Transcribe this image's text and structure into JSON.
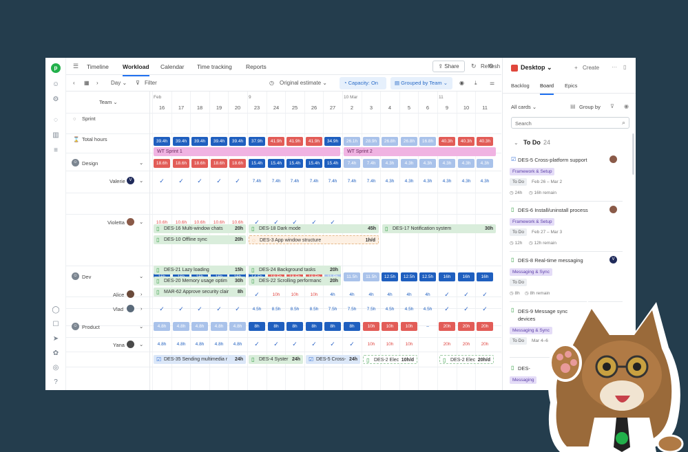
{
  "nav": {
    "tabs": [
      "Timeline",
      "Workload",
      "Calendar",
      "Time tracking",
      "Reports"
    ],
    "share": "Share",
    "refresh": "Refresh"
  },
  "toolbar": {
    "day": "Day",
    "filter": "Filter",
    "estimate": "Original estimate",
    "capacity": "Capacity: On",
    "grouped": "Grouped by Team"
  },
  "grid": {
    "team_label": "Team",
    "months": [
      {
        "label": "Feb",
        "col": 0
      },
      {
        "label": "9",
        "col": 5
      },
      {
        "label": "10 Mar",
        "col": 10
      },
      {
        "label": "11",
        "col": 15
      }
    ],
    "days": [
      "16",
      "17",
      "18",
      "19",
      "20",
      "23",
      "24",
      "25",
      "26",
      "27",
      "2",
      "3",
      "4",
      "5",
      "6",
      "9",
      "10",
      "11"
    ],
    "sprint_label": "Sprint",
    "sprints": [
      "WT Sprint 1",
      "WT Sprint 2"
    ],
    "total_label": "Total hours",
    "total_row": [
      "39.4h",
      "39.4h",
      "39.4h",
      "39.4h",
      "39.4h",
      "37.9h",
      "41.9h",
      "41.9h",
      "41.9h",
      "34.9h",
      "26.1h",
      "28.9h",
      "26.8h",
      "26.8h",
      "16.8h",
      "40.3h",
      "40.3h",
      "40.3h"
    ],
    "teams": {
      "design": "Design",
      "dev": "Dev",
      "product": "Product"
    },
    "design_row": [
      "18.6h",
      "18.6h",
      "18.6h",
      "18.6h",
      "18.6h",
      "15.4h",
      "15.4h",
      "15.4h",
      "15.4h",
      "15.4h",
      "7.4h",
      "7.4h",
      "4.3h",
      "4.3h",
      "4.3h",
      "4.3h",
      "4.3h",
      "4.3h"
    ],
    "valerie": {
      "name": "Valerie",
      "initial": "V",
      "row": [
        "✓",
        "✓",
        "✓",
        "✓",
        "✓",
        "7.4h",
        "7.4h",
        "7.4h",
        "7.4h",
        "7.4h",
        "7.4h",
        "7.4h",
        "4.3h",
        "4.3h",
        "4.3h",
        "4.3h",
        "4.3h",
        "4.3h"
      ]
    },
    "violetta": {
      "name": "Violetta",
      "row": [
        "10.6h",
        "10.6h",
        "10.6h",
        "10.6h",
        "10.6h",
        "✓",
        "✓",
        "✓",
        "✓",
        "✓",
        "",
        "",
        "",
        "",
        "",
        "",
        "",
        ""
      ]
    },
    "dev_row": [
      "16h",
      "16h",
      "16h",
      "16h",
      "16h",
      "14.5h",
      "18.5h",
      "18.5h",
      "18.5h",
      "11.5h",
      "11.5h",
      "11.5h",
      "12.5h",
      "12.5h",
      "12.5h",
      "16h",
      "16h",
      "16h"
    ],
    "alice": {
      "name": "Alice",
      "row": [
        "✓",
        "✓",
        "✓",
        "✓",
        "✓",
        "✓",
        "10h",
        "10h",
        "10h",
        "4h",
        "4h",
        "4h",
        "4h",
        "4h",
        "4h",
        "✓",
        "✓",
        "✓"
      ]
    },
    "vlad": {
      "name": "Vlad",
      "row": [
        "✓",
        "✓",
        "✓",
        "✓",
        "✓",
        "4.5h",
        "8.5h",
        "8.5h",
        "8.5h",
        "7.5h",
        "7.5h",
        "7.5h",
        "4.5h",
        "4.5h",
        "4.5h",
        "✓",
        "✓",
        "✓"
      ]
    },
    "product_row": [
      "4.8h",
      "4.8h",
      "4.8h",
      "4.8h",
      "4.8h",
      "8h",
      "8h",
      "8h",
      "8h",
      "8h",
      "8h",
      "10h",
      "10h",
      "10h",
      "–",
      "20h",
      "20h",
      "20h"
    ],
    "yana": {
      "name": "Yana",
      "row": [
        "4.8h",
        "4.8h",
        "4.8h",
        "4.8h",
        "4.8h",
        "✓",
        "✓",
        "✓",
        "✓",
        "✓",
        "✓",
        "10h",
        "10h",
        "10h",
        "",
        "20h",
        "20h",
        "20h"
      ]
    },
    "bars": [
      {
        "text": "DES-16 Multi-window chats",
        "hours": "20h"
      },
      {
        "text": "DES-10 Offline sync",
        "hours": "20h"
      },
      {
        "text": "DES-18 Dark mode",
        "hours": "45h"
      },
      {
        "text": "DES-3 App window structure",
        "hours": "1h/d"
      },
      {
        "text": "DES-17 Notification system",
        "hours": "30h"
      },
      {
        "text": "DES-21 Lazy loading",
        "hours": "15h"
      },
      {
        "text": "DES-20 Memory usage optim",
        "hours": "30h"
      },
      {
        "text": "MAR-62 Approve security clair",
        "hours": "8h"
      },
      {
        "text": "DES-24 Background tasks",
        "hours": "20h"
      },
      {
        "text": "DES-22 Scrolling performanc",
        "hours": "20h"
      },
      {
        "text": "DES-35 Sending multimedia r",
        "hours": "24h"
      },
      {
        "text": "DES-4 Syster",
        "hours": "24h"
      },
      {
        "text": "DES-5 Cross-",
        "hours": "24h"
      },
      {
        "text": "DES-2 Elec",
        "hours": "10h/d"
      },
      {
        "text": "DES-2 Elec",
        "hours": "20h/d"
      }
    ]
  },
  "panel": {
    "project": "Desktop",
    "create": "Create",
    "tabs": [
      "Backlog",
      "Board",
      "Epics"
    ],
    "all_cards": "All cards",
    "group_by": "Group by",
    "search_placeholder": "Search",
    "column_title": "To Do",
    "column_count": "24",
    "cards": [
      {
        "id": "DES-5",
        "title": "Cross-platform support",
        "tag": "Framework & Setup",
        "status": "To Do",
        "dates": "Feb 26 – Mar 2",
        "est": "24h",
        "remain": "16h remain"
      },
      {
        "id": "DES-6",
        "title": "Install/uninstall process",
        "tag": "Framework & Setup",
        "status": "To Do",
        "dates": "Feb 27 – Mar 3",
        "est": "12h",
        "remain": "12h remain"
      },
      {
        "id": "DES-8",
        "title": "Real-time messaging",
        "tag": "Messaging & Sync",
        "status": "To Do",
        "dates": "",
        "est": "8h",
        "remain": "8h remain"
      },
      {
        "id": "DES-9",
        "title": "Message sync devices",
        "tag": "Messaging & Sync",
        "status": "To Do",
        "dates": "Mar 4–6",
        "est": "",
        "remain": ""
      },
      {
        "id": "DES-",
        "title": "",
        "tag": "Messaging",
        "status": "",
        "dates": "",
        "est": "",
        "remain": ""
      }
    ]
  }
}
